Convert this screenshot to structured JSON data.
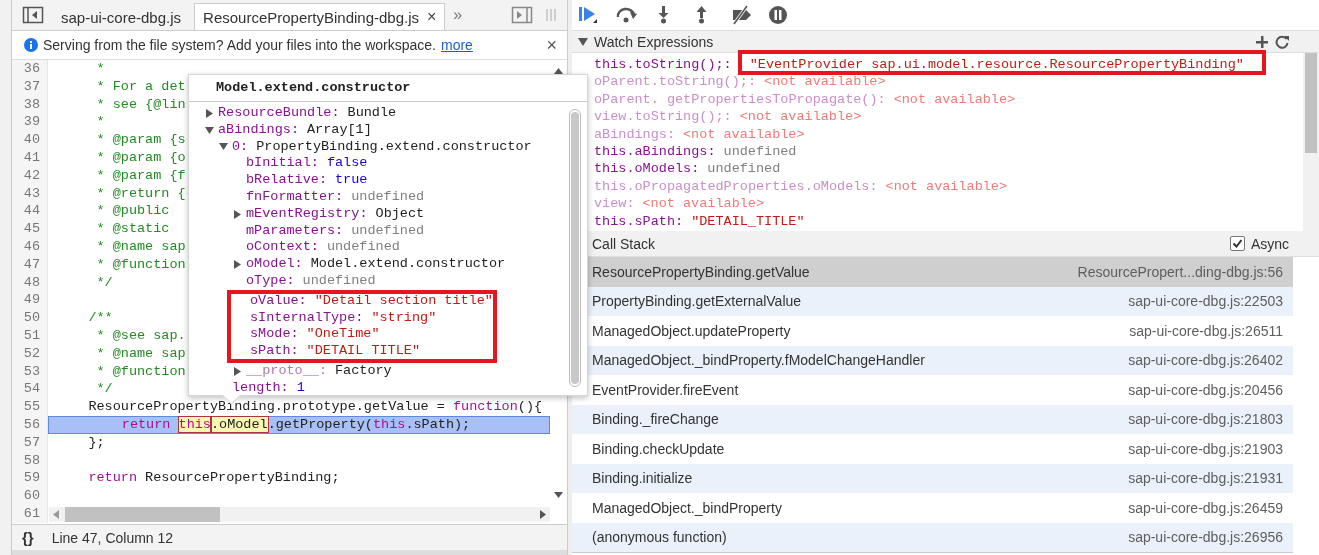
{
  "editor": {
    "tabs": [
      {
        "label": "sap-ui-core-dbg.js",
        "selected": false
      },
      {
        "label": "ResourcePropertyBinding-dbg.js",
        "selected": true,
        "close": "×"
      }
    ],
    "overflow": "»",
    "infobar": {
      "message": "Serving from the file system? Add your files into the workspace.",
      "link": "more",
      "close": "×"
    },
    "lines": [
      {
        "number": "36",
        "current": false,
        "segments": [
          {
            "text": "     *",
            "kind": "comment"
          }
        ]
      },
      {
        "number": "37",
        "current": false,
        "segments": [
          {
            "text": "     * For a det",
            "kind": "comment"
          }
        ]
      },
      {
        "number": "38",
        "current": false,
        "segments": [
          {
            "text": "     * see {@lin",
            "kind": "comment"
          }
        ]
      },
      {
        "number": "39",
        "current": false,
        "segments": [
          {
            "text": "     *",
            "kind": "comment"
          }
        ]
      },
      {
        "number": "40",
        "current": false,
        "segments": [
          {
            "text": "     * @param {s",
            "kind": "comment"
          }
        ]
      },
      {
        "number": "41",
        "current": false,
        "segments": [
          {
            "text": "     * @param {o",
            "kind": "comment"
          }
        ]
      },
      {
        "number": "42",
        "current": false,
        "segments": [
          {
            "text": "     * @param {f",
            "kind": "comment"
          }
        ]
      },
      {
        "number": "43",
        "current": false,
        "segments": [
          {
            "text": "     * @return {",
            "kind": "comment"
          }
        ]
      },
      {
        "number": "44",
        "current": false,
        "segments": [
          {
            "text": "     * @public",
            "kind": "comment"
          }
        ]
      },
      {
        "number": "45",
        "current": false,
        "segments": [
          {
            "text": "     * @static",
            "kind": "comment"
          }
        ]
      },
      {
        "number": "46",
        "current": false,
        "segments": [
          {
            "text": "     * @name sap",
            "kind": "comment"
          }
        ]
      },
      {
        "number": "47",
        "current": false,
        "segments": [
          {
            "text": "     * @function",
            "kind": "comment"
          }
        ]
      },
      {
        "number": "48",
        "current": false,
        "segments": [
          {
            "text": "     */",
            "kind": "comment"
          }
        ]
      },
      {
        "number": "49",
        "current": false
      },
      {
        "number": "50",
        "current": false,
        "segments": [
          {
            "text": "    /**",
            "kind": "comment"
          }
        ]
      },
      {
        "number": "51",
        "current": false,
        "segments": [
          {
            "text": "     * @see sap.",
            "kind": "comment"
          }
        ]
      },
      {
        "number": "52",
        "current": false,
        "segments": [
          {
            "text": "     * @name sap",
            "kind": "comment"
          }
        ]
      },
      {
        "number": "53",
        "current": false,
        "segments": [
          {
            "text": "     * @function",
            "kind": "comment"
          }
        ]
      },
      {
        "number": "54",
        "current": false,
        "segments": [
          {
            "text": "     */",
            "kind": "comment"
          }
        ]
      },
      {
        "number": "55",
        "current": false,
        "segments": [
          {
            "text": "    ResourcePropertyBinding.prototype.getValue = ",
            "kind": "plain"
          },
          {
            "text": "function",
            "kind": "keyword"
          },
          {
            "text": "(){",
            "kind": "plain"
          }
        ]
      },
      {
        "number": "56",
        "current": true,
        "segments": [
          {
            "text": "        return ",
            "kind": "keyword"
          },
          {
            "text": "this",
            "kind": "keyword",
            "hovered": true
          },
          {
            "text": ".oModel",
            "kind": "plain",
            "hovered": true
          },
          {
            "text": ".getProperty(",
            "kind": "plain"
          },
          {
            "text": "this",
            "kind": "keyword"
          },
          {
            "text": ".sPath);",
            "kind": "plain"
          }
        ]
      },
      {
        "number": "57",
        "current": false,
        "segments": [
          {
            "text": "    };",
            "kind": "plain"
          }
        ]
      },
      {
        "number": "58",
        "current": false
      },
      {
        "number": "59",
        "current": false,
        "segments": [
          {
            "text": "    return",
            "kind": "keyword"
          },
          {
            "text": " ResourcePropertyBinding;",
            "kind": "plain"
          }
        ]
      },
      {
        "number": "60",
        "current": false
      },
      {
        "number": "61",
        "current": false
      }
    ],
    "status": {
      "format": "{}",
      "position": "Line 47, Column 12"
    }
  },
  "popup": {
    "title": "Model.extend.constructor",
    "properties": [
      {
        "key": "ResourceBundle:",
        "value": "Bundle",
        "kind": "object",
        "expanded": false
      },
      {
        "key": "aBindings:",
        "value": "Array[1]",
        "kind": "object",
        "expanded": true,
        "children": [
          {
            "key": "0:",
            "value": "PropertyBinding.extend.constructor",
            "kind": "object",
            "expanded": true,
            "children": [
              {
                "key": "bInitial:",
                "value": "false",
                "kind": "boolean"
              },
              {
                "key": "bRelative:",
                "value": "true",
                "kind": "boolean"
              },
              {
                "key": "fnFormatter:",
                "value": "undefined",
                "kind": "undefined"
              },
              {
                "key": "mEventRegistry:",
                "value": "Object",
                "kind": "object",
                "expanded": false
              },
              {
                "key": "mParameters:",
                "value": "undefined",
                "kind": "undefined"
              },
              {
                "key": "oContext:",
                "value": "undefined",
                "kind": "undefined"
              },
              {
                "key": "oModel:",
                "value": "Model.extend.constructor",
                "kind": "object",
                "expanded": false
              },
              {
                "key": "oType:",
                "value": "undefined",
                "kind": "undefined"
              },
              {
                "key": "oValue:",
                "value": "\"Detail section title\"",
                "kind": "string",
                "highlighted": true
              },
              {
                "key": "sInternalType:",
                "value": "\"string\"",
                "kind": "string",
                "highlighted": true
              },
              {
                "key": "sMode:",
                "value": "\"OneTime\"",
                "kind": "string",
                "highlighted": true
              },
              {
                "key": "sPath:",
                "value": "\"DETAIL TITLE\"",
                "kind": "string",
                "highlighted": true
              },
              {
                "key": "__proto__:",
                "value": "Factory",
                "kind": "object",
                "expanded": false,
                "internal": true
              }
            ]
          },
          {
            "key": "length:",
            "value": "1",
            "kind": "number"
          }
        ]
      }
    ]
  },
  "debugger": {
    "toolbar": [
      {
        "kind": "resume",
        "active": true
      },
      {
        "kind": "step-over",
        "active": false
      },
      {
        "kind": "step-into",
        "active": false
      },
      {
        "kind": "step-out",
        "active": false
      },
      {
        "kind": "deactivate",
        "active": false
      },
      {
        "kind": "pause",
        "active": false
      }
    ],
    "watch": {
      "title": "Watch Expressions",
      "expanded": true,
      "items": [
        {
          "name": "this.toString();:",
          "value": "\"EventProvider sap.ui.model.resource.ResourcePropertyBinding\"",
          "kind": "string",
          "available": true,
          "highlighted": true
        },
        {
          "name": "oParent.toString();:",
          "value": "<not available>",
          "kind": "error",
          "available": false
        },
        {
          "name": "oParent. getPropertiesToPropagate():",
          "value": "<not available>",
          "kind": "error",
          "available": false
        },
        {
          "name": "view.toString();:",
          "value": "<not available>",
          "kind": "error",
          "available": false
        },
        {
          "name": "aBindings:",
          "value": "<not available>",
          "kind": "error",
          "available": false
        },
        {
          "name": "this.aBindings:",
          "value": "undefined",
          "kind": "undefined",
          "available": true
        },
        {
          "name": "this.oModels:",
          "value": "undefined",
          "kind": "undefined",
          "available": true
        },
        {
          "name": "this.oPropagatedProperties.oModels:",
          "value": "<not available>",
          "kind": "error",
          "available": false
        },
        {
          "name": "view:",
          "value": "<not available>",
          "kind": "error",
          "available": false
        },
        {
          "name": "this.sPath:",
          "value": "\"DETAIL_TITLE\"",
          "kind": "string",
          "available": true
        }
      ]
    },
    "call_stack": {
      "title": "Call Stack",
      "async": {
        "label": "Async",
        "checked": true
      },
      "frames": [
        {
          "function": "ResourcePropertyBinding.getValue",
          "location": "ResourcePropert...ding-dbg.js:56",
          "selected": true
        },
        {
          "function": "PropertyBinding.getExternalValue",
          "location": "sap-ui-core-dbg.js:22503",
          "selected": false
        },
        {
          "function": "ManagedObject.updateProperty",
          "location": "sap-ui-core-dbg.js:26511",
          "selected": false
        },
        {
          "function": "ManagedObject._bindProperty.fModelChangeHandler",
          "location": "sap-ui-core-dbg.js:26402",
          "selected": false
        },
        {
          "function": "EventProvider.fireEvent",
          "location": "sap-ui-core-dbg.js:20456",
          "selected": false
        },
        {
          "function": "Binding._fireChange",
          "location": "sap-ui-core-dbg.js:21803",
          "selected": false
        },
        {
          "function": "Binding.checkUpdate",
          "location": "sap-ui-core-dbg.js:21903",
          "selected": false
        },
        {
          "function": "Binding.initialize",
          "location": "sap-ui-core-dbg.js:21931",
          "selected": false
        },
        {
          "function": "ManagedObject._bindProperty",
          "location": "sap-ui-core-dbg.js:26459",
          "selected": false
        },
        {
          "function": "(anonymous function)",
          "location": "sap-ui-core-dbg.js:26956",
          "selected": false
        }
      ]
    }
  }
}
